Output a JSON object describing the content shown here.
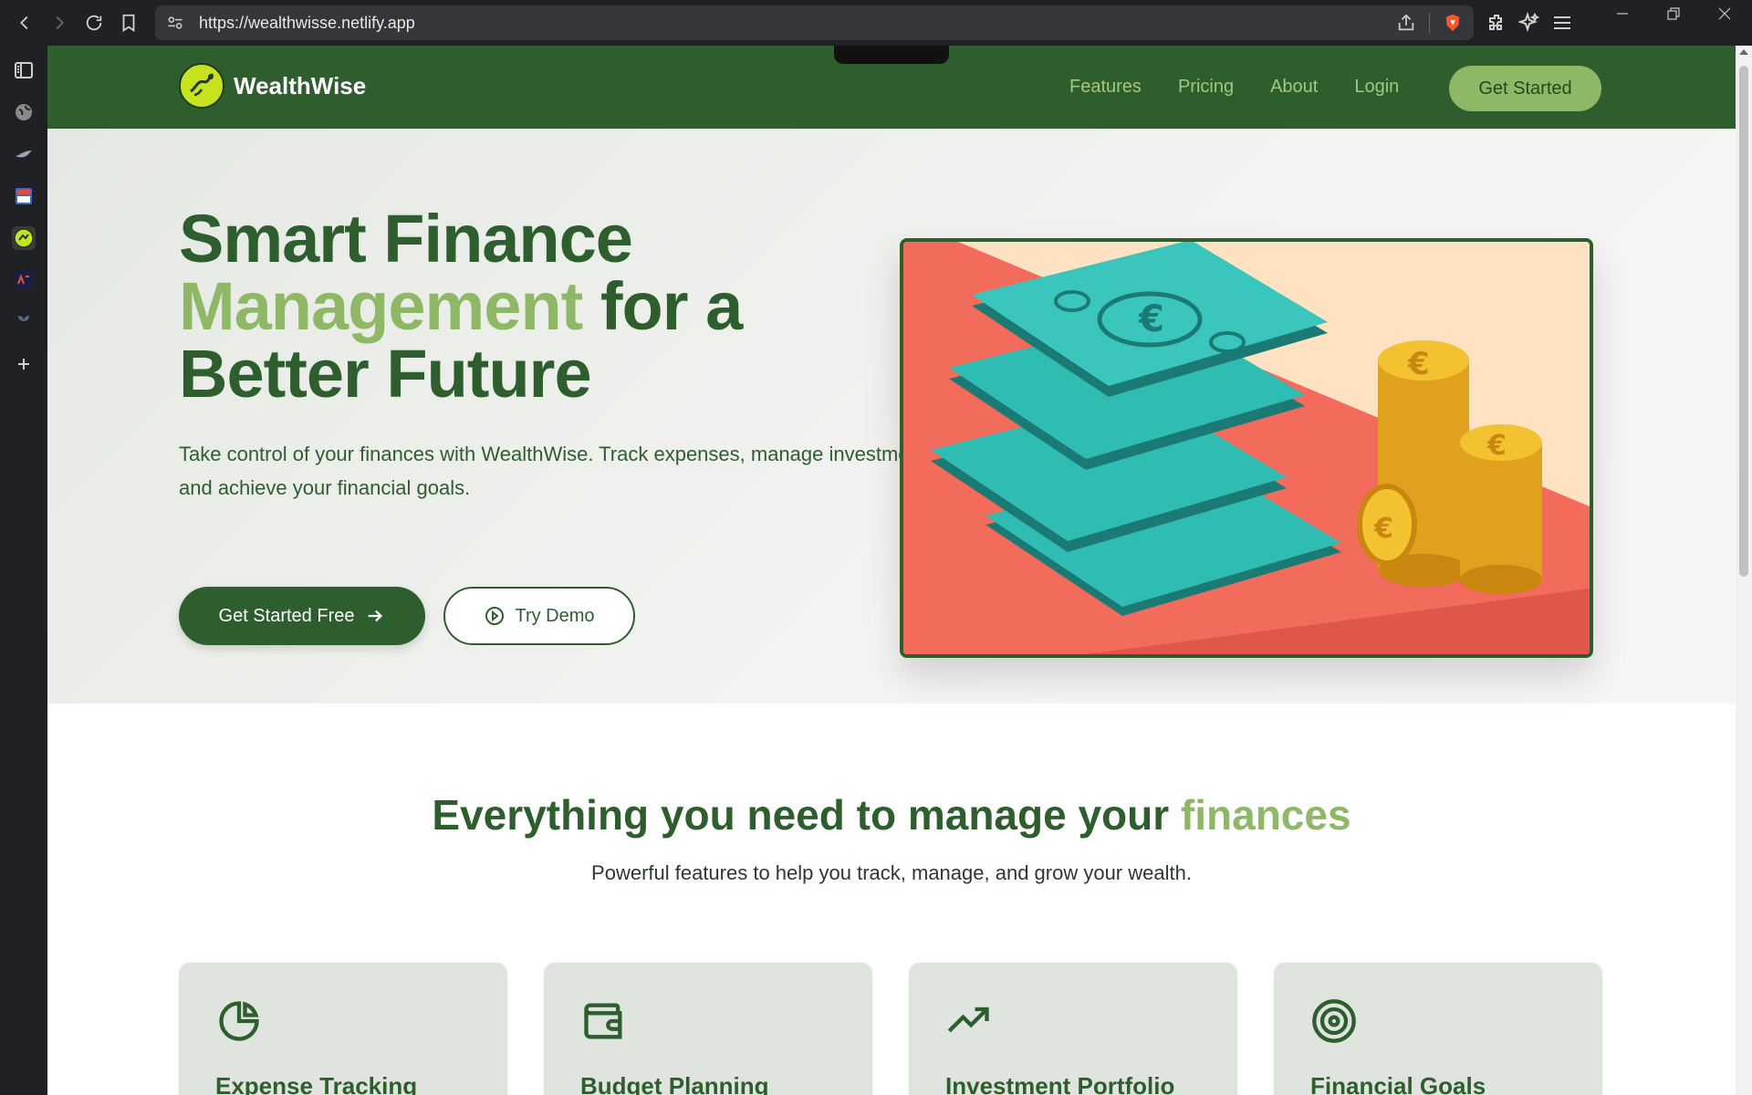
{
  "browser": {
    "url": "https://wealthwisse.netlify.app"
  },
  "navbar": {
    "brand": "WealthWise",
    "links": [
      "Features",
      "Pricing",
      "About",
      "Login"
    ],
    "cta": "Get Started"
  },
  "hero": {
    "title_line1": "Smart Finance",
    "title_accent": "Management",
    "title_line2_rest": " for a",
    "title_line3": "Better Future",
    "subtitle": "Take control of your finances with WealthWise. Track expenses, manage investments, and achieve your financial goals.",
    "primary_button": "Get Started Free",
    "secondary_button": "Try Demo"
  },
  "features": {
    "title_main": "Everything you need to manage your ",
    "title_accent": "finances",
    "subtitle": "Powerful features to help you track, manage, and grow your wealth.",
    "cards": [
      {
        "title": "Expense Tracking",
        "icon": "pie-chart-icon"
      },
      {
        "title": "Budget Planning",
        "icon": "wallet-icon"
      },
      {
        "title": "Investment Portfolio",
        "icon": "trending-up-icon"
      },
      {
        "title": "Financial Goals",
        "icon": "target-icon"
      }
    ]
  },
  "colors": {
    "primary": "#2e5e2e",
    "accent": "#8fb866",
    "chrome": "#202124"
  }
}
